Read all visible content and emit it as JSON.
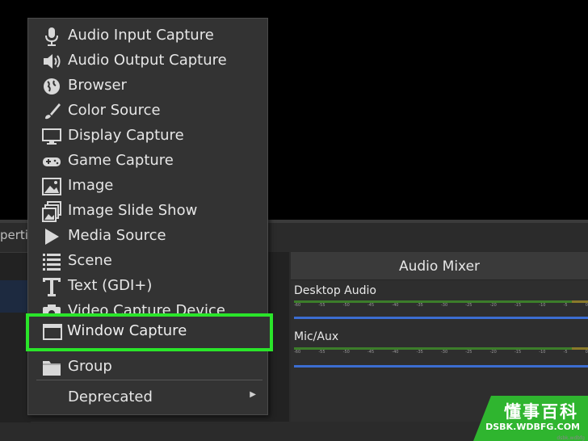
{
  "dock": {
    "properties_label_partial": "perties"
  },
  "menu": {
    "items": [
      {
        "label": "Audio Input Capture",
        "icon": "microphone-icon"
      },
      {
        "label": "Audio Output Capture",
        "icon": "speaker-icon"
      },
      {
        "label": "Browser",
        "icon": "globe-icon"
      },
      {
        "label": "Color Source",
        "icon": "paintbrush-icon"
      },
      {
        "label": "Display Capture",
        "icon": "monitor-icon"
      },
      {
        "label": "Game Capture",
        "icon": "gamepad-icon"
      },
      {
        "label": "Image",
        "icon": "image-icon"
      },
      {
        "label": "Image Slide Show",
        "icon": "image-stack-icon"
      },
      {
        "label": "Media Source",
        "icon": "play-icon"
      },
      {
        "label": "Scene",
        "icon": "list-icon"
      },
      {
        "label": "Text (GDI+)",
        "icon": "text-icon"
      },
      {
        "label": "Video Capture Device",
        "icon": "camera-icon"
      },
      {
        "label": "Window Capture",
        "icon": "window-icon"
      },
      {
        "label": "Group",
        "icon": "folder-icon"
      },
      {
        "label": "Deprecated",
        "icon": ""
      }
    ],
    "highlighted": "Window Capture",
    "highlight_color": "#2ae52a"
  },
  "mixer": {
    "title": "Audio Mixer",
    "tracks": [
      {
        "name": "Desktop Audio"
      },
      {
        "name": "Mic/Aux"
      }
    ],
    "ticks": [
      "-60",
      "-55",
      "-50",
      "-45",
      "-40",
      "-35",
      "-30",
      "-25",
      "-20",
      "-15",
      "-10",
      "-5",
      "0"
    ]
  },
  "bottom_tools": "+ − ⚙ ∧ ∨",
  "watermark": {
    "cn": "懂事百科",
    "en": "DSBK.WDBFG.COM",
    "tiny": "dsbk.wdbfg"
  }
}
